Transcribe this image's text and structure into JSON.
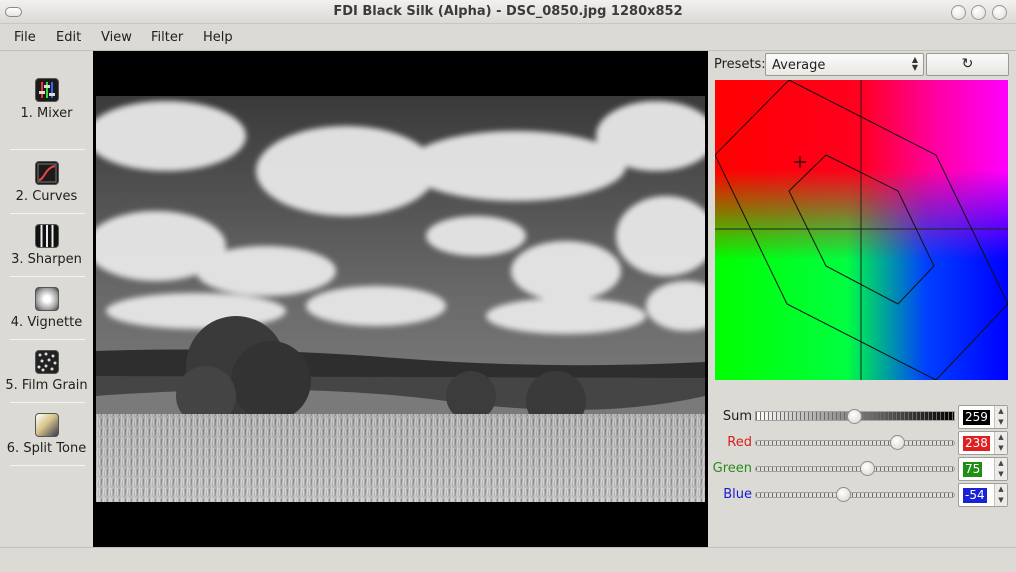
{
  "window": {
    "title": "FDI Black Silk (Alpha) - DSC_0850.jpg 1280x852"
  },
  "menu": [
    "File",
    "Edit",
    "View",
    "Filter",
    "Help"
  ],
  "tools": [
    {
      "label": "1. Mixer",
      "icon": "mixer-icon"
    },
    {
      "label": "2. Curves",
      "icon": "curves-icon"
    },
    {
      "label": "3. Sharpen",
      "icon": "sharpen-icon"
    },
    {
      "label": "4. Vignette",
      "icon": "vignette-icon"
    },
    {
      "label": "5. Film Grain",
      "icon": "film-grain-icon"
    },
    {
      "label": "6. Split Tone",
      "icon": "split-tone-icon"
    }
  ],
  "presets": {
    "label": "Presets:",
    "value": "Average",
    "reset_symbol": "↻"
  },
  "channels": {
    "sum": {
      "label": "Sum",
      "value": "259",
      "level": 0.51,
      "color": "#202020",
      "box_color": "#000000"
    },
    "red": {
      "label": "Red",
      "value": "238",
      "level": 0.72,
      "color": "#d42020",
      "box_color": "#e0201e"
    },
    "green": {
      "label": "Green",
      "value": "75",
      "level": 0.56,
      "color": "#2a8a1e",
      "box_color": "#1e8f12"
    },
    "blue": {
      "label": "Blue",
      "value": "-54",
      "level": 0.44,
      "color": "#1a1ad0",
      "box_color": "#1a22d8"
    }
  }
}
